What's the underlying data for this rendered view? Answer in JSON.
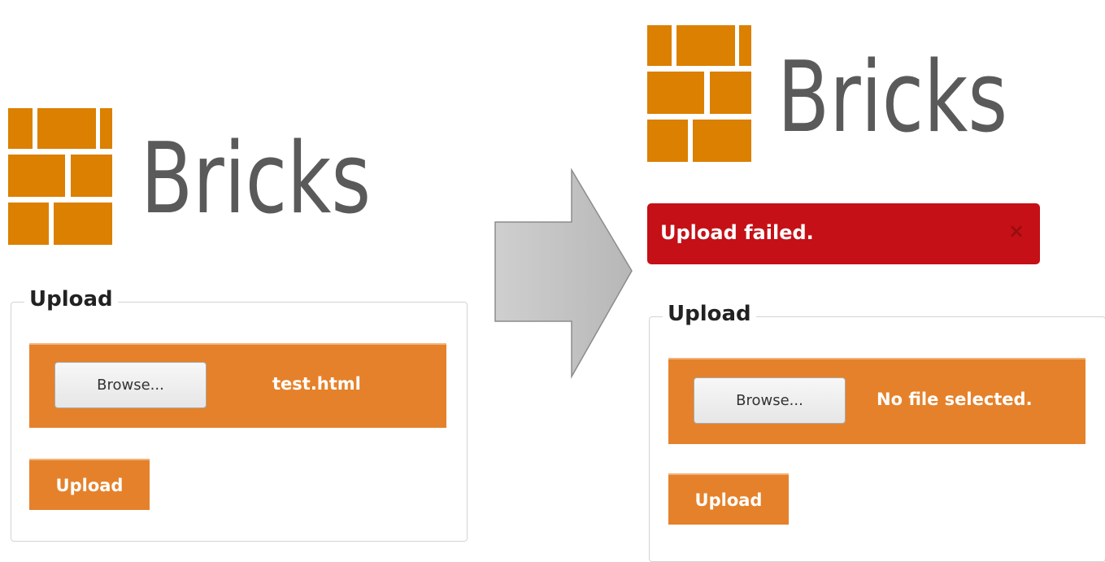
{
  "colors": {
    "brand_orange": "#e5812a",
    "brick_orange": "#db8000",
    "error_red": "#c41016",
    "logo_text_gray": "#5a5a5a",
    "arrow_gray": "#c4c4c4"
  },
  "before": {
    "logo_text": "Bricks",
    "legend": "Upload",
    "browse_label": "Browse...",
    "file_status": "test.html",
    "upload_label": "Upload"
  },
  "transition_arrow": {
    "icon": "right-arrow-icon"
  },
  "after": {
    "logo_text": "Bricks",
    "alert": {
      "message": "Upload failed.",
      "close_symbol": "×"
    },
    "legend": "Upload",
    "browse_label": "Browse...",
    "file_status": "No file selected.",
    "upload_label": "Upload"
  }
}
